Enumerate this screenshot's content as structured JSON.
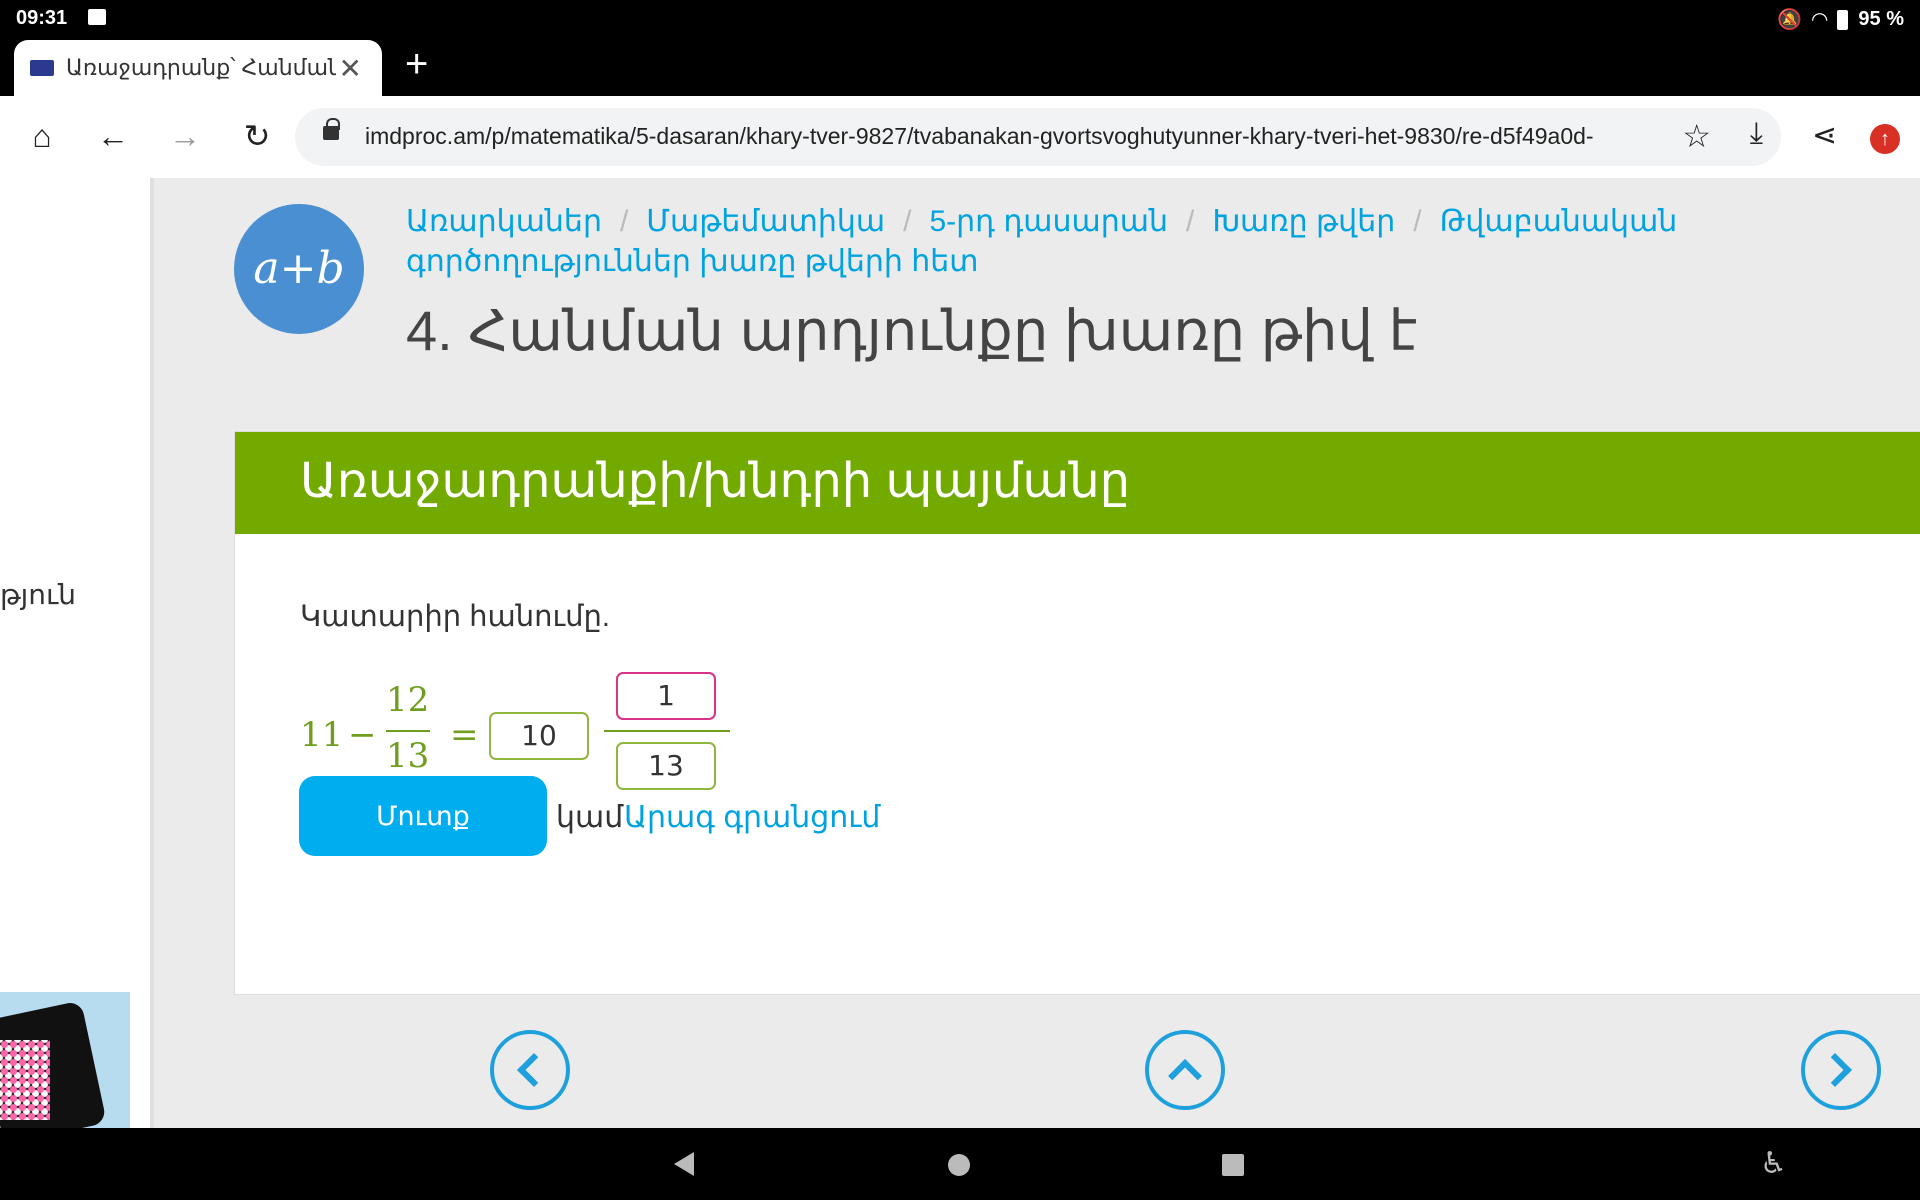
{
  "status_bar": {
    "time": "09:31",
    "battery": "95 %"
  },
  "browser": {
    "tab_title": "Առաջադրանք՝ Հանման արդյունքը խառը թիվ է",
    "new_tab": "+",
    "tab_close": "✕",
    "url": "imdproc.am/p/matematika/5-dasaran/khary-tver-9827/tvabanakan-gvortsvoghutyunner-khary-tveri-het-9830/re-d5f49a0d-",
    "icons": {
      "home": "⌂",
      "back": "←",
      "forward": "→",
      "reload": "↻",
      "star": "☆",
      "download": "⤓",
      "share": "⋖",
      "extension": "↑"
    }
  },
  "sidebar": {
    "partial_text": "թյուն"
  },
  "logo": {
    "text": "a+b"
  },
  "breadcrumb": [
    "Առարկաներ",
    "Մաթեմատիկա",
    "5-րդ դասարան",
    "Խառը թվեր",
    "Թվաբանական գործողություններ խառը թվերի հետ"
  ],
  "page": {
    "title": "4. Հանման արդյունքը խառը թիվ է",
    "card_header": "Առաջադրանքի/խնդրի պայմանը",
    "instruction": "Կատարիր հանումը."
  },
  "equation": {
    "minuend": "11",
    "minus": "−",
    "frac_numerator": "12",
    "frac_denominator": "13",
    "equals": "=",
    "answer_whole": "10",
    "answer_numerator": "1",
    "answer_denominator": "13"
  },
  "actions": {
    "enter_label": "Մուտք",
    "or_text": "կամ",
    "quick_register": "Արագ գրանցում"
  },
  "colors": {
    "accent_green": "#73aa00",
    "link_blue": "#00a3e0",
    "button_blue": "#00aeef",
    "logo_blue": "#4a8fd1"
  }
}
